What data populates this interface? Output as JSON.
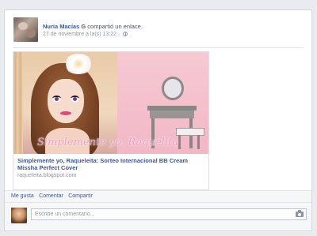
{
  "post": {
    "author": "Nuria Macías G",
    "action": "compartió un enlace.",
    "timestamp": "27 de noviembre a la(s) 13:22 ·",
    "privacy_icon": "globe-icon"
  },
  "link_preview": {
    "image_caption": "Simplemente yo, Raquelita",
    "title": "Simplemente yo, Raqueleita: Sorteo Internacional BB Cream Missha Perfect Cover",
    "domain": "raqueleita.blogspot.com"
  },
  "actions": {
    "like": "Me gusta",
    "comment": "Comentar",
    "share": "Compartir",
    "separator": "·"
  },
  "comment_box": {
    "placeholder": "Escribe un comentario..."
  },
  "colors": {
    "link": "#3b5998",
    "background": "#e9ebee",
    "muted": "#90949c"
  }
}
